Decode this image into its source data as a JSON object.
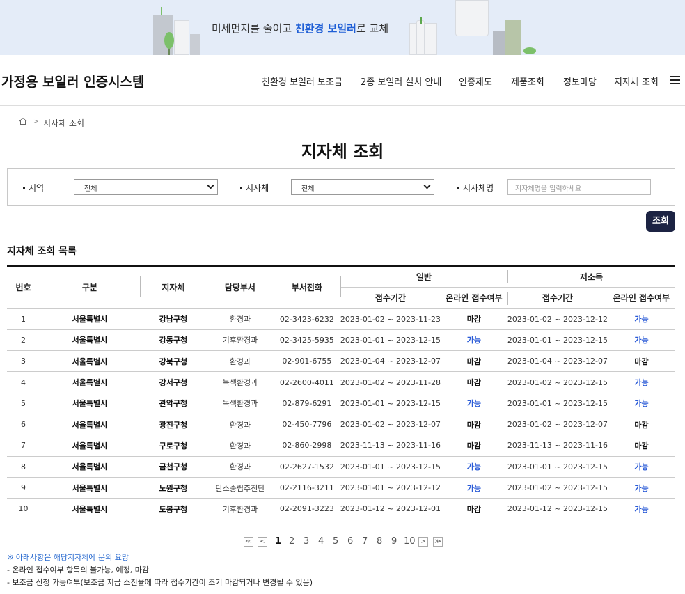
{
  "banner": {
    "text_prefix": "미세먼지를 줄이고 ",
    "text_highlight": "친환경 보일러",
    "text_suffix": "로 교체",
    "accent_color": "#1f5fd6"
  },
  "header": {
    "logo": "가정용 보일러 인증시스템",
    "nav": [
      "친환경 보일러 보조금",
      "2종 보일러 설치 안내",
      "인증제도",
      "제품조회",
      "정보마당",
      "지자체 조회"
    ],
    "menu_icon": "hamburger-icon"
  },
  "breadcrumb": {
    "home_icon": "home-icon",
    "current": "지자체 조회"
  },
  "page_title": "지자체 조회",
  "search": {
    "region_label": "지역",
    "region_value": "전체",
    "local_label": "지자체",
    "local_value": "전체",
    "name_label": "지자체명",
    "name_placeholder": "지자체명을 입력하세요",
    "button": "조회"
  },
  "list_title": "지자체 조회 목록",
  "table": {
    "headers": {
      "no": "번호",
      "category": "구분",
      "local": "지자체",
      "dept": "담당부서",
      "phone": "부서전화",
      "general": "일반",
      "low_income": "저소득",
      "period": "접수기간",
      "online": "온라인 접수여부"
    },
    "rows": [
      {
        "no": "1",
        "category": "서울특별시",
        "local": "강남구청",
        "dept": "환경과",
        "phone": "02-3423-6232",
        "g_period": "2023-01-02 ~ 2023-11-23",
        "g_online": "마감",
        "l_period": "2023-01-02 ~ 2023-12-12",
        "l_online": "가능"
      },
      {
        "no": "2",
        "category": "서울특별시",
        "local": "강동구청",
        "dept": "기후환경과",
        "phone": "02-3425-5935",
        "g_period": "2023-01-01 ~ 2023-12-15",
        "g_online": "가능",
        "l_period": "2023-01-01 ~ 2023-12-15",
        "l_online": "가능"
      },
      {
        "no": "3",
        "category": "서울특별시",
        "local": "강북구청",
        "dept": "환경과",
        "phone": "02-901-6755",
        "g_period": "2023-01-04 ~ 2023-12-07",
        "g_online": "마감",
        "l_period": "2023-01-04 ~ 2023-12-07",
        "l_online": "마감"
      },
      {
        "no": "4",
        "category": "서울특별시",
        "local": "강서구청",
        "dept": "녹색환경과",
        "phone": "02-2600-4011",
        "g_period": "2023-01-02 ~ 2023-11-28",
        "g_online": "마감",
        "l_period": "2023-01-02 ~ 2023-12-15",
        "l_online": "가능"
      },
      {
        "no": "5",
        "category": "서울특별시",
        "local": "관악구청",
        "dept": "녹색환경과",
        "phone": "02-879-6291",
        "g_period": "2023-01-01 ~ 2023-12-15",
        "g_online": "가능",
        "l_period": "2023-01-01 ~ 2023-12-15",
        "l_online": "가능"
      },
      {
        "no": "6",
        "category": "서울특별시",
        "local": "광진구청",
        "dept": "환경과",
        "phone": "02-450-7796",
        "g_period": "2023-01-02 ~ 2023-12-07",
        "g_online": "마감",
        "l_period": "2023-01-02 ~ 2023-12-07",
        "l_online": "마감"
      },
      {
        "no": "7",
        "category": "서울특별시",
        "local": "구로구청",
        "dept": "환경과",
        "phone": "02-860-2998",
        "g_period": "2023-11-13 ~ 2023-11-16",
        "g_online": "마감",
        "l_period": "2023-11-13 ~ 2023-11-16",
        "l_online": "마감"
      },
      {
        "no": "8",
        "category": "서울특별시",
        "local": "금천구청",
        "dept": "환경과",
        "phone": "02-2627-1532",
        "g_period": "2023-01-01 ~ 2023-12-15",
        "g_online": "가능",
        "l_period": "2023-01-01 ~ 2023-12-15",
        "l_online": "가능"
      },
      {
        "no": "9",
        "category": "서울특별시",
        "local": "노원구청",
        "dept": "탄소중립추진단",
        "phone": "02-2116-3211",
        "g_period": "2023-01-01 ~ 2023-12-12",
        "g_online": "가능",
        "l_period": "2023-01-02 ~ 2023-12-15",
        "l_online": "가능"
      },
      {
        "no": "10",
        "category": "서울특별시",
        "local": "도봉구청",
        "dept": "기후환경과",
        "phone": "02-2091-3223",
        "g_period": "2023-01-12 ~ 2023-12-01",
        "g_online": "마감",
        "l_period": "2023-01-12 ~ 2023-12-15",
        "l_online": "가능"
      }
    ],
    "open_color": "#2a5bd7"
  },
  "pagination": {
    "first": "≪",
    "prev": "<",
    "next": ">",
    "last": "≫",
    "pages": [
      "1",
      "2",
      "3",
      "4",
      "5",
      "6",
      "7",
      "8",
      "9",
      "10"
    ],
    "current": "1"
  },
  "notes": {
    "title": "※ 아래사항은 해당지자체에 문의 요망",
    "items": [
      "- 온라인 접수여부 항목의 불가능, 예정, 마감",
      "- 보조금 신청 가능여부(보조금 지급 소진율에 따라 접수기간이 조기 마감되거나 변경될 수 있음)"
    ]
  }
}
